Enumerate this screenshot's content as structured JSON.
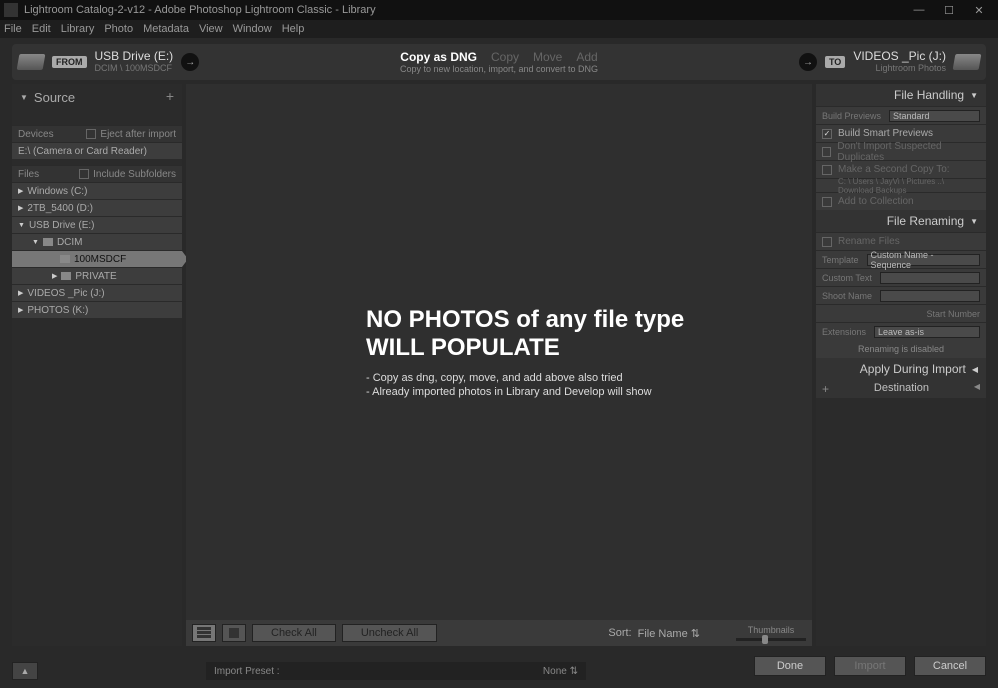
{
  "titlebar": {
    "title": "Lightroom Catalog-2-v12 - Adobe Photoshop Lightroom Classic - Library",
    "min": "—",
    "max": "☐",
    "close": "✕"
  },
  "menu": [
    "File",
    "Edit",
    "Library",
    "Photo",
    "Metadata",
    "View",
    "Window",
    "Help"
  ],
  "header": {
    "from_badge": "FROM",
    "from_drive": "USB Drive (E:)",
    "from_sub": "DCIM \\ 100MSDCF",
    "modes": {
      "copy_dng": "Copy as DNG",
      "copy": "Copy",
      "move": "Move",
      "add": "Add"
    },
    "sub": "Copy to new location, import, and convert to DNG",
    "to_badge": "TO",
    "to_drive": "VIDEOS _Pic (J:)",
    "to_sub": "Lightroom Photos"
  },
  "left": {
    "title": "Source",
    "devices_label": "Devices",
    "eject_label": "Eject after import",
    "device_row": "E:\\ (Camera or Card Reader)",
    "files_label": "Files",
    "include_label": "Include Subfolders",
    "drives": {
      "c": "Windows (C:)",
      "d": "2TB_5400 (D:)",
      "e": "USB Drive (E:)",
      "dcim": "DCIM",
      "sel": "100MSDCF",
      "priv": "PRIVATE",
      "j": "VIDEOS _Pic (J:)",
      "k": "PHOTOS (K:)"
    }
  },
  "center": {
    "line1": "NO PHOTOS of any file type",
    "line2": "WILL POPULATE",
    "note1": "- Copy as dng, copy, move, and add above also tried",
    "note2": "- Already imported photos in Library and Develop will show",
    "check_all": "Check All",
    "uncheck_all": "Uncheck All",
    "sort_label": "Sort:",
    "sort_value": "File Name",
    "thumb_label": "Thumbnails"
  },
  "right": {
    "file_handling": "File Handling",
    "build_previews_label": "Build Previews",
    "build_previews_value": "Standard",
    "smart": "Build Smart Previews",
    "dupes": "Don't Import Suspected Duplicates",
    "second_copy": "Make a Second Copy To:",
    "second_path": "C: \\ Users \\ JayVi \\ Pictures ..\\ Download Backups",
    "add_collection": "Add to Collection",
    "file_renaming": "File Renaming",
    "rename_files": "Rename Files",
    "template_label": "Template",
    "template_value": "Custom Name - Sequence",
    "custom_text": "Custom Text",
    "shoot_name": "Shoot Name",
    "start_num": "Start Number",
    "ext_label": "Extensions",
    "ext_value": "Leave as-is",
    "rename_note": "Renaming is disabled",
    "apply_import": "Apply During Import",
    "destination": "Destination"
  },
  "footer": {
    "preset_label": "Import Preset :",
    "preset_value": "None",
    "done": "Done",
    "import": "Import",
    "cancel": "Cancel"
  }
}
